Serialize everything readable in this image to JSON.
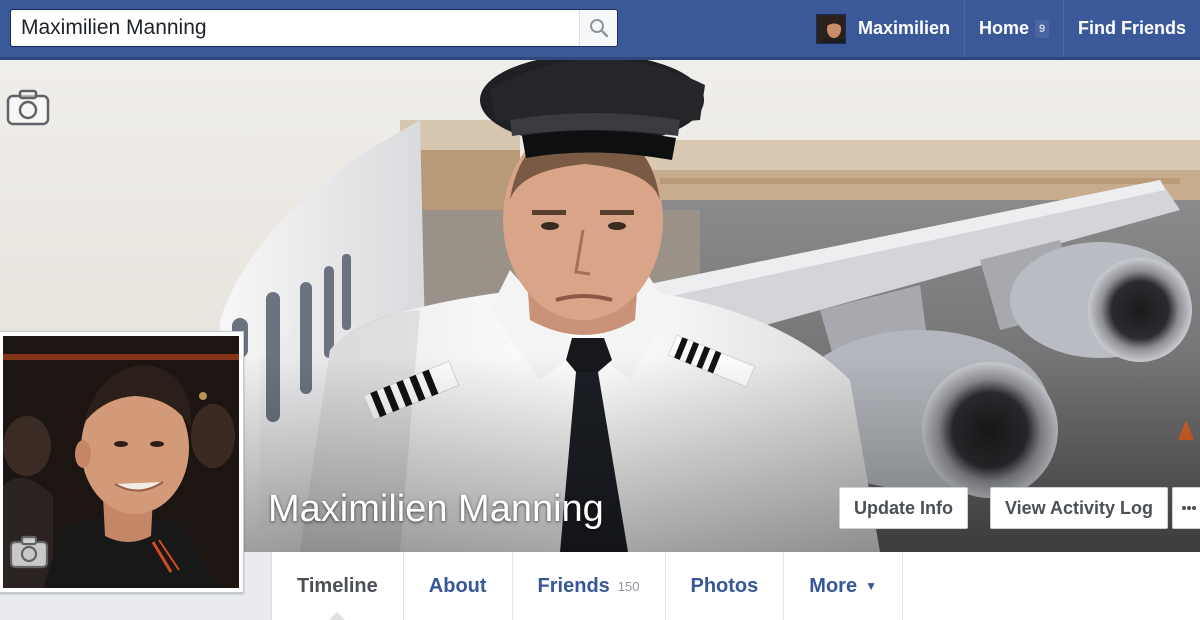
{
  "topbar": {
    "search_value": "Maximilien Manning",
    "search_icon": "magnifier-icon",
    "user_name": "Maximilien",
    "home_label": "Home",
    "home_count": "9",
    "find_friends_label": "Find Friends"
  },
  "cover": {
    "name": "Maximilien Manning",
    "update_info_label": "Update Info",
    "view_activity_log_label": "View Activity Log",
    "camera_icon": "camera-icon"
  },
  "tabs": [
    {
      "label": "Timeline",
      "active": true
    },
    {
      "label": "About"
    },
    {
      "label": "Friends",
      "count": "150"
    },
    {
      "label": "Photos"
    },
    {
      "label": "More"
    }
  ],
  "colors": {
    "brand_blue": "#3b5998",
    "link_blue": "#365899",
    "muted_text": "#90949c"
  }
}
